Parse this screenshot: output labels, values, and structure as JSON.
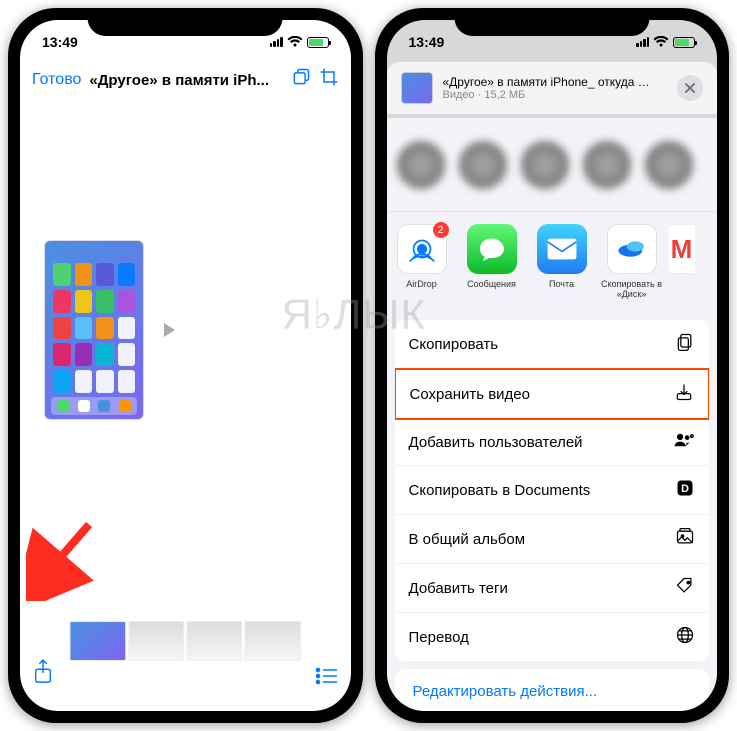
{
  "watermark": "Я♭ЛЫК",
  "status": {
    "time": "13:49"
  },
  "phone1": {
    "done": "Готово",
    "title": "«Другое» в памяти iPh..."
  },
  "phone2": {
    "share_title": "«Другое» в памяти iPhone_ откуда б...",
    "share_subtitle": "Видео · 15,2 МБ",
    "airdrop_badge": "2",
    "apps": {
      "airdrop": "AirDrop",
      "messages": "Сообщения",
      "mail": "Почта",
      "yadisk": "Скопировать в «Диск»",
      "gmail": "M"
    },
    "actions": {
      "copy": "Скопировать",
      "save_video": "Сохранить видео",
      "add_users": "Добавить пользователей",
      "copy_documents": "Скопировать в Documents",
      "shared_album": "В общий альбом",
      "add_tags": "Добавить теги",
      "translate": "Перевод"
    },
    "edit_actions": "Редактировать действия..."
  }
}
